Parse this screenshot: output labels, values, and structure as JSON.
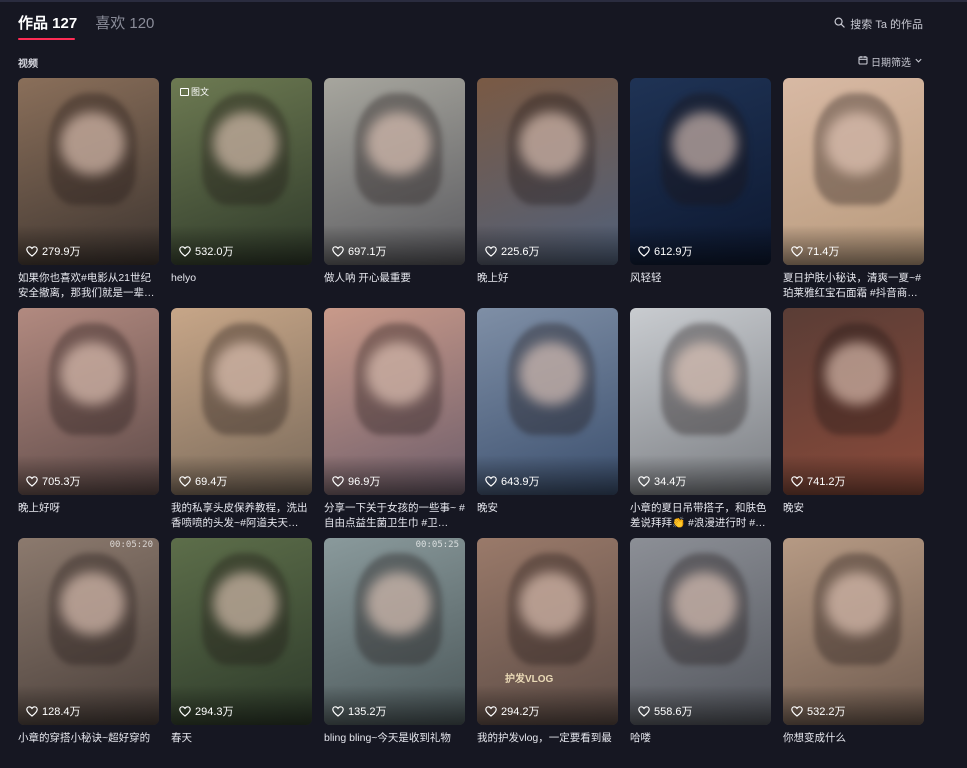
{
  "tabs": [
    {
      "label": "作品 127",
      "active": true
    },
    {
      "label": "喜欢 120",
      "active": false
    }
  ],
  "search": {
    "label": "搜索 Ta 的作品",
    "icon": "search-icon"
  },
  "section": {
    "label": "视频"
  },
  "filter": {
    "label": "日期筛选",
    "icon": "calendar-icon"
  },
  "colors": {
    "accent": "#fe2c55",
    "background": "#161722"
  },
  "videos": [
    {
      "likes": "279.9万",
      "caption": "如果你也喜欢#电影从21世纪安全撤离，那我们就是一辈…",
      "thumb": [
        "#8a6f5a",
        "#3e3530"
      ]
    },
    {
      "likes": "532.0万",
      "caption": "helyo",
      "badge": "图文",
      "thumb": [
        "#6d7a52",
        "#2f3a2a"
      ]
    },
    {
      "likes": "697.1万",
      "caption": "做人呐 开心最重要",
      "thumb": [
        "#a7a69e",
        "#5a5a5f"
      ]
    },
    {
      "likes": "225.6万",
      "caption": "晚上好",
      "thumb": [
        "#7a5a44",
        "#50607a"
      ]
    },
    {
      "likes": "612.9万",
      "caption": "风轻轻",
      "thumb": [
        "#1f3355",
        "#0d1830"
      ]
    },
    {
      "likes": "71.4万",
      "caption": "夏日护肤小秘诀，清爽一夏~#珀莱雅红宝石面霜 #抖音商…",
      "thumb": [
        "#d8b9a4",
        "#b89a7c"
      ]
    },
    {
      "likes": "705.3万",
      "caption": "晚上好呀",
      "thumb": [
        "#b28a80",
        "#5e4a48"
      ]
    },
    {
      "likes": "69.4万",
      "caption": "我的私享头皮保养教程，洗出香喷喷的头发~#阿道夫天…",
      "thumb": [
        "#c7a688",
        "#7a6a5a"
      ]
    },
    {
      "likes": "96.9万",
      "caption": "分享一下关于女孩的一些事~ #自由点益生菌卫生巾 #卫…",
      "thumb": [
        "#c99a8a",
        "#6e5d6a"
      ]
    },
    {
      "likes": "643.9万",
      "caption": "晚安",
      "thumb": [
        "#7f8fa6",
        "#3b4f6e"
      ]
    },
    {
      "likes": "34.4万",
      "caption": "小章的夏日吊带搭子，和肤色差说拜拜👏 #浪漫进行时 #…",
      "thumb": [
        "#c9ccd0",
        "#7a7d82"
      ]
    },
    {
      "likes": "741.2万",
      "caption": "晚安",
      "thumb": [
        "#5a3d36",
        "#8a4a3a"
      ]
    },
    {
      "likes": "128.4万",
      "caption": "小章的穿搭小秘诀~超好穿的",
      "timestamp": "00:05:20",
      "thumb": [
        "#8c7a6e",
        "#4a3f3a"
      ]
    },
    {
      "likes": "294.3万",
      "caption": "春天",
      "thumb": [
        "#5d6e4a",
        "#2d3a2a"
      ]
    },
    {
      "likes": "135.2万",
      "caption": "bling bling~今天是收到礼物",
      "timestamp": "00:05:25",
      "thumb": [
        "#8a9a9c",
        "#4a5658"
      ]
    },
    {
      "likes": "294.2万",
      "caption": "我的护发vlog，一定要看到最",
      "overlay": "护发VLOG",
      "thumb": [
        "#9a7a6a",
        "#5a4a44"
      ]
    },
    {
      "likes": "558.6万",
      "caption": "哈喽",
      "thumb": [
        "#8c8f96",
        "#53565d"
      ]
    },
    {
      "likes": "532.2万",
      "caption": "你想变成什么",
      "thumb": [
        "#b69a84",
        "#6e5a4e"
      ]
    }
  ]
}
